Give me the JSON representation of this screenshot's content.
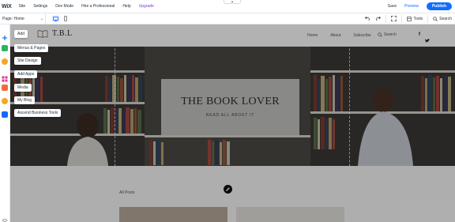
{
  "topbar": {
    "logo": "WiX",
    "menu": [
      "Site",
      "Settings",
      "Dev Mode",
      "Hire a Professional",
      "Help",
      "Upgrade"
    ],
    "save": "Save",
    "preview": "Preview",
    "publish": "Publish"
  },
  "toolbar": {
    "page": "Page: Home",
    "tools": "Tools",
    "search": "Search"
  },
  "add_panel": [
    "Add",
    "Menus & Pages",
    "Site Design",
    "Add Apps",
    "Media",
    "My Blog",
    "Ascend Business Tools"
  ],
  "site": {
    "logo_text": "T.B.L",
    "nav": [
      "Home",
      "About",
      "Subscribe"
    ],
    "search": "Search",
    "hero_title": "THE BOOK LOVER",
    "hero_subtitle": "READ ALL ABOUT IT",
    "all_posts": "All Posts"
  },
  "colors": {
    "accent": "#116dff",
    "upgrade": "#7a3fd6",
    "sidebar_icons": [
      "#116dff",
      "#2bb55c",
      "#f5a623",
      "#e0338f",
      "#f26a3c",
      "#f5a623",
      "#116dff"
    ]
  }
}
